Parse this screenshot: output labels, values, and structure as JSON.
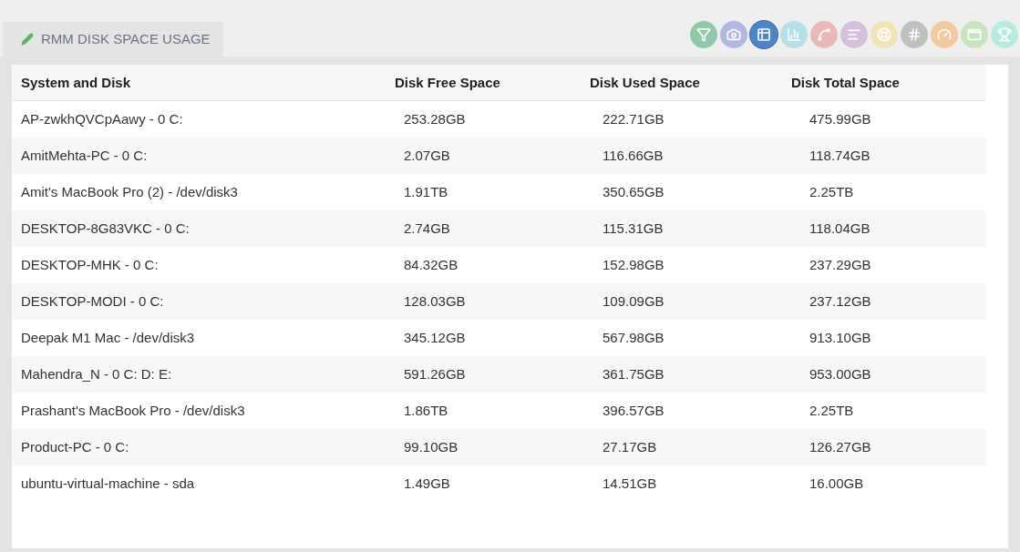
{
  "tab": {
    "title": "RMM DISK SPACE USAGE"
  },
  "toolbar": [
    {
      "kind": "funnel",
      "color": "#8fc9a8",
      "selected": false
    },
    {
      "kind": "camera",
      "color": "#b3b8e0",
      "selected": false
    },
    {
      "kind": "table",
      "color": "#4a86c8",
      "selected": true
    },
    {
      "kind": "bars",
      "color": "#b5e0ea",
      "selected": false
    },
    {
      "kind": "line",
      "color": "#eab8b8",
      "selected": false
    },
    {
      "kind": "hbars",
      "color": "#d5c0dd",
      "selected": false
    },
    {
      "kind": "wheel",
      "color": "#f1e4b4",
      "selected": false
    },
    {
      "kind": "hash",
      "color": "#c0c0c0",
      "selected": false
    },
    {
      "kind": "gauge",
      "color": "#f5c9a0",
      "selected": false
    },
    {
      "kind": "window",
      "color": "#c8e5c0",
      "selected": false
    },
    {
      "kind": "trophy",
      "color": "#b5ece0",
      "selected": false
    }
  ],
  "table": {
    "columns": [
      "System and Disk",
      "Disk Free Space",
      "Disk Used Space",
      "Disk Total Space"
    ],
    "rows": [
      [
        "AP-zwkhQVCpAawy - 0 C:",
        "253.28GB",
        "222.71GB",
        "475.99GB"
      ],
      [
        "AmitMehta-PC - 0 C:",
        "2.07GB",
        "116.66GB",
        "118.74GB"
      ],
      [
        "Amit's MacBook Pro (2) - /dev/disk3",
        "1.91TB",
        "350.65GB",
        "2.25TB"
      ],
      [
        "DESKTOP-8G83VKC - 0 C:",
        "2.74GB",
        "115.31GB",
        "118.04GB"
      ],
      [
        "DESKTOP-MHK - 0 C:",
        "84.32GB",
        "152.98GB",
        "237.29GB"
      ],
      [
        "DESKTOP-MODI - 0 C:",
        "128.03GB",
        "109.09GB",
        "237.12GB"
      ],
      [
        "Deepak M1 Mac - /dev/disk3",
        "345.12GB",
        "567.98GB",
        "913.10GB"
      ],
      [
        "Mahendra_N - 0 C: D: E:",
        "591.26GB",
        "361.75GB",
        "953.00GB"
      ],
      [
        "Prashant's MacBook Pro - /dev/disk3",
        "1.86TB",
        "396.57GB",
        "2.25TB"
      ],
      [
        "Product-PC - 0 C:",
        "99.10GB",
        "27.17GB",
        "126.27GB"
      ],
      [
        "ubuntu-virtual-machine - sda",
        "1.49GB",
        "14.51GB",
        "16.00GB"
      ]
    ]
  }
}
